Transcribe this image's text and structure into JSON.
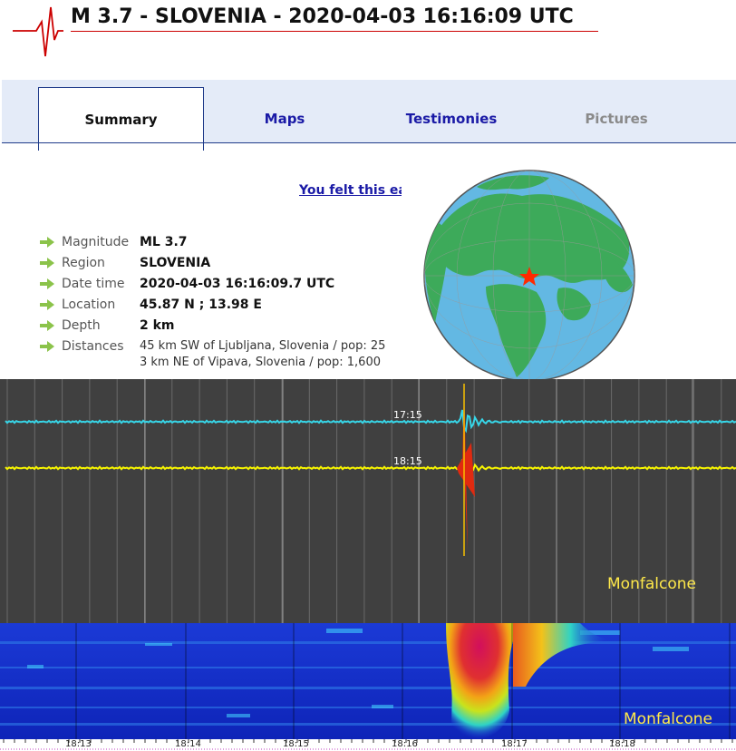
{
  "header": {
    "title": "M 3.7 - SLOVENIA - 2020-04-03 16:16:09 UTC"
  },
  "tabs": [
    {
      "label": "Summary",
      "state": "active"
    },
    {
      "label": "Maps",
      "state": "link"
    },
    {
      "label": "Testimonies",
      "state": "link"
    },
    {
      "label": "Pictures",
      "state": "disabled"
    }
  ],
  "felt_link": "You felt this ea",
  "details": [
    {
      "label": "Magnitude",
      "value": "ML 3.7"
    },
    {
      "label": "Region",
      "value": "SLOVENIA"
    },
    {
      "label": "Date time",
      "value": "2020-04-03 16:16:09.7 UTC"
    },
    {
      "label": "Location",
      "value": "45.87 N ; 13.98 E"
    },
    {
      "label": "Depth",
      "value": "2 km"
    },
    {
      "label": "Distances",
      "value": "45 km SW of Ljubljana, Slovenia / pop: 25"
    }
  ],
  "distance_line2": "3 km NE of Vipava, Slovenia / pop: 1,600",
  "seismogram": {
    "trace_labels": [
      "17:15",
      "18:15"
    ],
    "trace_colors": [
      "#37d6e8",
      "#f7f500"
    ],
    "station": "Monfalcone"
  },
  "spectrogram": {
    "station": "Monfalcone"
  },
  "timeline": {
    "labels": [
      "18:13",
      "18:14",
      "18:15",
      "18:16",
      "18:17",
      "18:18"
    ]
  },
  "colors": {
    "accent_red": "#cc0000",
    "link_blue": "#1a1aa6",
    "tab_bg": "#e4ebf8",
    "arrow_green": "#8bc34a",
    "ocean": "#63b8e3",
    "land": "#3daa5a"
  }
}
